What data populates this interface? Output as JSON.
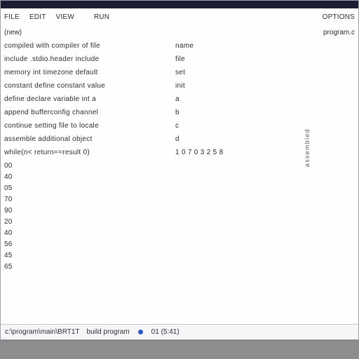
{
  "toolbar": {
    "items": [
      "FILE",
      "EDIT",
      "VIEW",
      "",
      "RUN"
    ],
    "right": "OPTIONS"
  },
  "subbar": {
    "left": "(new)",
    "right": "program.c"
  },
  "lines": [
    {
      "a": "compiled  with compiler of file",
      "b": "name",
      "c": "",
      "d": ""
    },
    {
      "a": "include .stdio.header include",
      "b": "file",
      "c": "",
      "d": ""
    },
    {
      "a": "memory   int  timezone default",
      "b": "set",
      "c": "",
      "d": ""
    },
    {
      "a": "constant define constant value",
      "b": "init",
      "c": "",
      "d": ""
    },
    {
      "a": "define   declare variable int a",
      "b": "a",
      "c": "",
      "d": ""
    },
    {
      "a": "append   bufferconfig channel",
      "b": "b",
      "c": "",
      "d": ""
    },
    {
      "a": "continue  setting file to locale",
      "b": "c",
      "c": "",
      "d": ""
    },
    {
      "a": "assemble  additional object",
      "b": "d",
      "c": "",
      "d": ""
    },
    {
      "a": "while(n<  return==result  0)",
      "b": " 1  0 7 0 3 2 5 8",
      "c": "",
      "d": ""
    }
  ],
  "left_numbers": [
    "00",
    "40",
    "05",
    "70",
    "90",
    "20",
    "40",
    "56",
    "45",
    "65",
    " "
  ],
  "side_label": "assembled",
  "status": {
    "path": "c:\\program\\main\\BRT1T",
    "mid": "build  program",
    "right": "01  (5:41)"
  }
}
